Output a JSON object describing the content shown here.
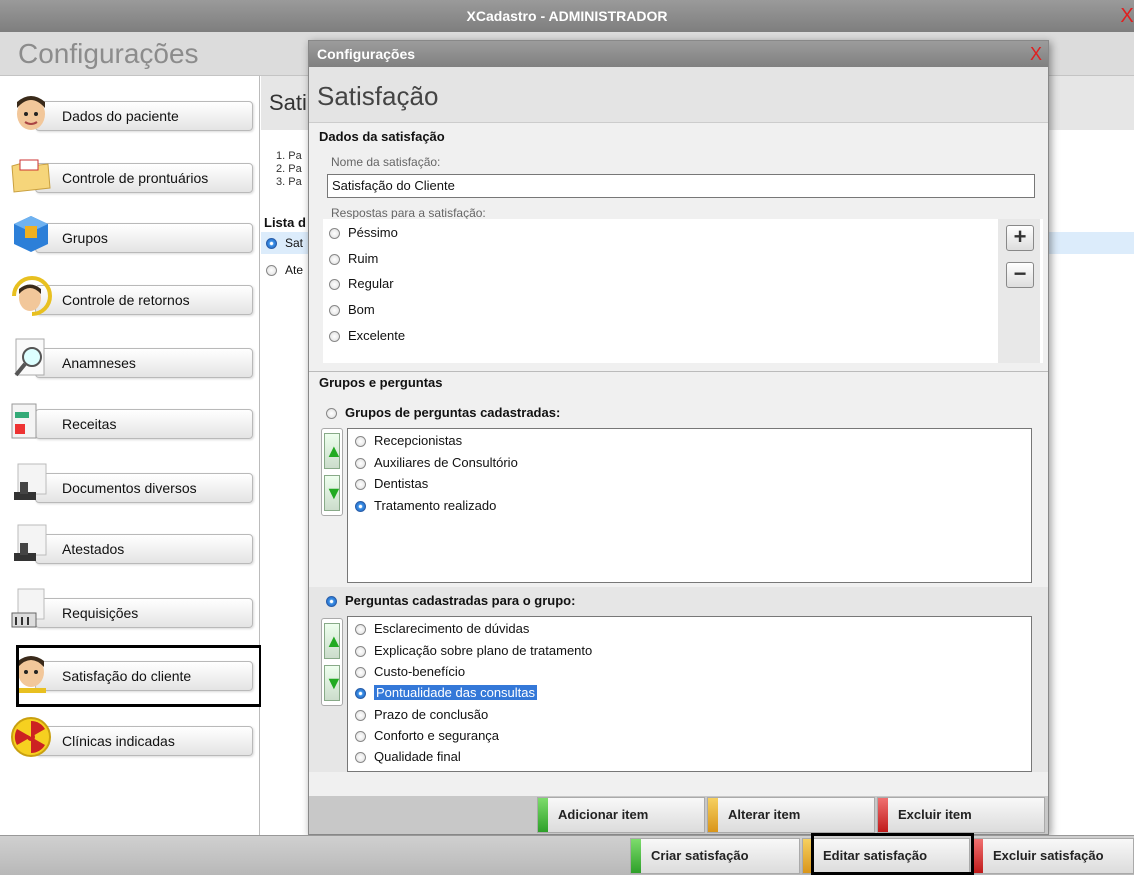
{
  "window": {
    "title": "XCadastro - ADMINISTRADOR",
    "close": "X"
  },
  "header": {
    "title": "Configurações"
  },
  "sidebar": {
    "items": [
      {
        "label": "Dados do paciente",
        "icon": "patient-face-icon"
      },
      {
        "label": "Controle de prontuários",
        "icon": "folder-icon"
      },
      {
        "label": "Grupos",
        "icon": "cube-icon"
      },
      {
        "label": "Controle de retornos",
        "icon": "return-face-icon"
      },
      {
        "label": "Anamneses",
        "icon": "magnifier-icon"
      },
      {
        "label": "Receitas",
        "icon": "prescription-icon"
      },
      {
        "label": "Documentos diversos",
        "icon": "stamp-icon"
      },
      {
        "label": "Atestados",
        "icon": "stamp-icon"
      },
      {
        "label": "Requisições",
        "icon": "requisition-icon"
      },
      {
        "label": "Satisfação do cliente",
        "icon": "satisfaction-face-icon"
      },
      {
        "label": "Clínicas indicadas",
        "icon": "radiation-icon"
      }
    ]
  },
  "background": {
    "title": "Sati",
    "steps": [
      "1. Pa",
      "2. Pa",
      "3. Pa"
    ],
    "list_label": "Lista d",
    "rows": [
      "Sat",
      "Ate"
    ]
  },
  "modal": {
    "window_title": "Configurações",
    "close": "X",
    "title": "Satisfação",
    "section_dados": "Dados da satisfação",
    "name_label": "Nome da satisfação:",
    "name_value": "Satisfação do Cliente",
    "answers_label": "Respostas para a satisfação:",
    "answers": [
      "Péssimo",
      "Ruim",
      "Regular",
      "Bom",
      "Excelente"
    ],
    "add_symbol": "+",
    "remove_symbol": "−",
    "section_grupos": "Grupos e perguntas",
    "groups_label": "Grupos de perguntas cadastradas:",
    "groups": [
      "Recepcionistas",
      "Auxiliares de Consultório",
      "Dentistas",
      "Tratamento realizado"
    ],
    "groups_selected": 3,
    "questions_label": "Perguntas cadastradas para o grupo:",
    "questions": [
      "Esclarecimento de dúvidas",
      "Explicação sobre plano de tratamento",
      "Custo-benefício",
      "Pontualidade das consultas",
      "Prazo de conclusão",
      "Conforto e segurança",
      "Qualidade final"
    ],
    "questions_selected": 3,
    "up_arrow": "▲",
    "down_arrow": "▼",
    "buttons": {
      "add": "Adicionar item",
      "edit": "Alterar item",
      "delete": "Excluir item"
    },
    "colors": {
      "add": "#3cb83c",
      "edit": "#e0a020",
      "delete": "#d02020"
    }
  },
  "bottom": {
    "create": "Criar satisfação",
    "edit": "Editar satisfação",
    "delete": "Excluir satisfação"
  }
}
